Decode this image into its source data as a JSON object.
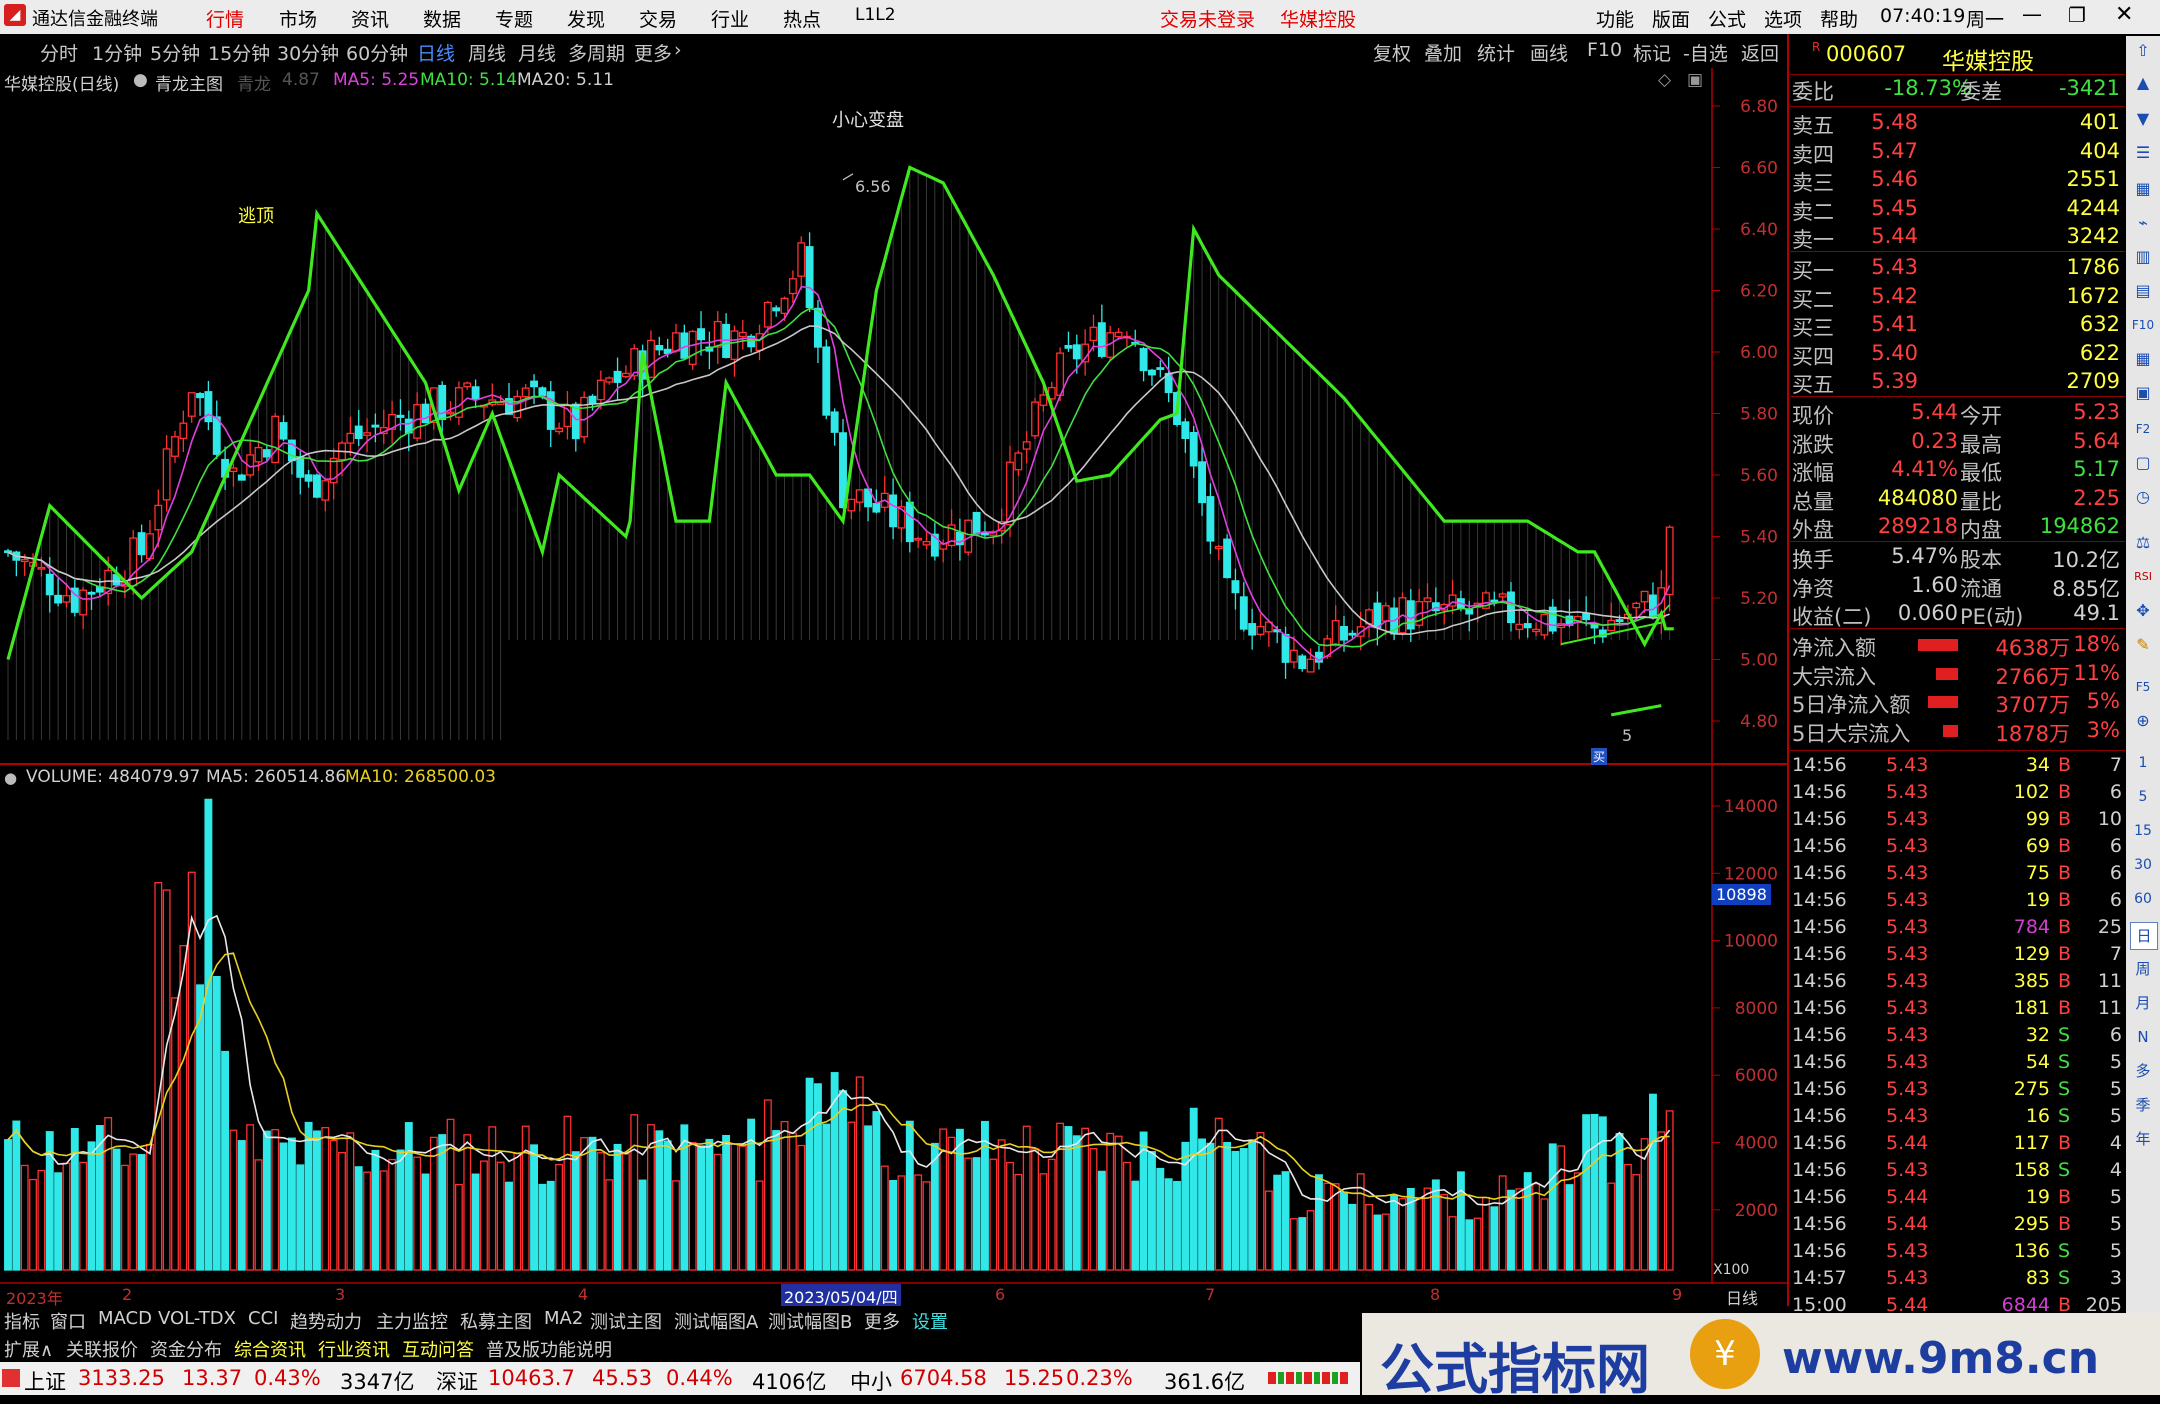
{
  "titlebar": {
    "app_name": "通达信金融终端",
    "menu": [
      "行情",
      "市场",
      "资讯",
      "数据",
      "专题",
      "发现",
      "交易",
      "行业",
      "热点",
      "L1L2"
    ],
    "trade_status": "交易未登录",
    "stock_name": "华媒控股",
    "right_menu": [
      "功能",
      "版面",
      "公式",
      "选项",
      "帮助"
    ],
    "clock": "07:40:19",
    "weekday": "周一"
  },
  "periods": [
    "分时",
    "1分钟",
    "5分钟",
    "15分钟",
    "30分钟",
    "60分钟",
    "日线",
    "周线",
    "月线",
    "多周期",
    "更多"
  ],
  "period_active": "日线",
  "chart_tools": [
    "复权",
    "叠加",
    "统计",
    "画线",
    "F10",
    "标记",
    "-自选",
    "返回"
  ],
  "main_info": {
    "title": "华媒控股(日线)",
    "indicator": "青龙主图",
    "ind_name": "青龙",
    "ind_value": "4.87",
    "ma5": "MA5: 5.25",
    "ma10": "MA10: 5.14",
    "ma20": "MA20: 5.11"
  },
  "annotations": {
    "warn": "小心变盘",
    "top_escape": "逃顶",
    "high_mark": "6.56",
    "low_num": "5",
    "low_tag": "买"
  },
  "price_axis": [
    "6.80",
    "6.60",
    "6.40",
    "6.20",
    "6.00",
    "5.80",
    "5.60",
    "5.40",
    "5.20",
    "5.00",
    "4.80"
  ],
  "volume_info": {
    "label": "VOLUME: 484079.97",
    "ma5": "MA5: 260514.86",
    "ma10": "MA10: 268500.03"
  },
  "volume_axis": [
    "14000",
    "12000",
    "10000",
    "8000",
    "6000",
    "4000",
    "2000"
  ],
  "volume_highlight": "10898",
  "volume_unit": "X100",
  "date_axis": {
    "year": "2023年",
    "m2": "2",
    "m3": "3",
    "m4": "4",
    "cursor": "2023/05/04/四",
    "m6": "6",
    "m7": "7",
    "m8": "8",
    "m9": "9",
    "period": "日线"
  },
  "quote": {
    "code": "000607",
    "name": "华媒控股",
    "flag": "R",
    "weibi_label": "委比",
    "weibi": "-18.73%",
    "weicha_label": "委差",
    "weicha": "-3421",
    "asks": [
      {
        "l": "卖五",
        "p": "5.48",
        "v": "401"
      },
      {
        "l": "卖四",
        "p": "5.47",
        "v": "404"
      },
      {
        "l": "卖三",
        "p": "5.46",
        "v": "2551"
      },
      {
        "l": "卖二",
        "p": "5.45",
        "v": "4244"
      },
      {
        "l": "卖一",
        "p": "5.44",
        "v": "3242"
      }
    ],
    "bids": [
      {
        "l": "买一",
        "p": "5.43",
        "v": "1786"
      },
      {
        "l": "买二",
        "p": "5.42",
        "v": "1672"
      },
      {
        "l": "买三",
        "p": "5.41",
        "v": "632"
      },
      {
        "l": "买四",
        "p": "5.40",
        "v": "622"
      },
      {
        "l": "买五",
        "p": "5.39",
        "v": "2709"
      }
    ],
    "stats1": [
      {
        "a": "现价",
        "b": "5.44",
        "c": "今开",
        "d": "5.23"
      },
      {
        "a": "涨跌",
        "b": "0.23",
        "c": "最高",
        "d": "5.64"
      },
      {
        "a": "涨幅",
        "b": "4.41%",
        "c": "最低",
        "d": "5.17"
      },
      {
        "a": "总量",
        "b": "484080",
        "c": "量比",
        "d": "2.25"
      },
      {
        "a": "外盘",
        "b": "289218",
        "c": "内盘",
        "d": "194862"
      }
    ],
    "stats2": [
      {
        "a": "换手",
        "b": "5.47%",
        "c": "股本",
        "d": "10.2亿"
      },
      {
        "a": "净资",
        "b": "1.60",
        "c": "流通",
        "d": "8.85亿"
      },
      {
        "a": "收益(二)",
        "b": "0.060",
        "c": "PE(动)",
        "d": "49.1"
      }
    ],
    "flows": [
      {
        "a": "净流入额",
        "b": "4638万",
        "c": "18%",
        "w": 40
      },
      {
        "a": "大宗流入",
        "b": "2766万",
        "c": "11%",
        "w": 22
      },
      {
        "a": "5日净流入额",
        "b": "3707万",
        "c": "5%",
        "w": 30
      },
      {
        "a": "5日大宗流入",
        "b": "1878万",
        "c": "3%",
        "w": 15
      }
    ]
  },
  "ticks": [
    {
      "t": "14:56",
      "p": "5.43",
      "v": "34",
      "s": "B",
      "n": "7"
    },
    {
      "t": "14:56",
      "p": "5.43",
      "v": "102",
      "s": "B",
      "n": "6"
    },
    {
      "t": "14:56",
      "p": "5.43",
      "v": "99",
      "s": "B",
      "n": "10"
    },
    {
      "t": "14:56",
      "p": "5.43",
      "v": "69",
      "s": "B",
      "n": "6"
    },
    {
      "t": "14:56",
      "p": "5.43",
      "v": "75",
      "s": "B",
      "n": "6"
    },
    {
      "t": "14:56",
      "p": "5.43",
      "v": "19",
      "s": "B",
      "n": "6"
    },
    {
      "t": "14:56",
      "p": "5.43",
      "v": "784",
      "s": "B",
      "n": "25"
    },
    {
      "t": "14:56",
      "p": "5.43",
      "v": "129",
      "s": "B",
      "n": "7"
    },
    {
      "t": "14:56",
      "p": "5.43",
      "v": "385",
      "s": "B",
      "n": "11"
    },
    {
      "t": "14:56",
      "p": "5.43",
      "v": "181",
      "s": "B",
      "n": "11"
    },
    {
      "t": "14:56",
      "p": "5.43",
      "v": "32",
      "s": "S",
      "n": "6"
    },
    {
      "t": "14:56",
      "p": "5.43",
      "v": "54",
      "s": "S",
      "n": "5"
    },
    {
      "t": "14:56",
      "p": "5.43",
      "v": "275",
      "s": "S",
      "n": "5"
    },
    {
      "t": "14:56",
      "p": "5.43",
      "v": "16",
      "s": "S",
      "n": "5"
    },
    {
      "t": "14:56",
      "p": "5.44",
      "v": "117",
      "s": "B",
      "n": "4"
    },
    {
      "t": "14:56",
      "p": "5.43",
      "v": "158",
      "s": "S",
      "n": "4"
    },
    {
      "t": "14:56",
      "p": "5.44",
      "v": "19",
      "s": "B",
      "n": "5"
    },
    {
      "t": "14:56",
      "p": "5.44",
      "v": "295",
      "s": "B",
      "n": "5"
    },
    {
      "t": "14:56",
      "p": "5.43",
      "v": "136",
      "s": "S",
      "n": "5"
    },
    {
      "t": "14:57",
      "p": "5.43",
      "v": "83",
      "s": "S",
      "n": "3"
    },
    {
      "t": "15:00",
      "p": "5.44",
      "v": "6844",
      "s": "B",
      "n": "205"
    }
  ],
  "tabs_row1": [
    "指标",
    "窗口",
    "MACD",
    "VOL-TDX",
    "CCI",
    "趋势动力",
    "主力监控",
    "私募主图",
    "MA2",
    "测试主图",
    "测试幅图A",
    "测试幅图B",
    "更多",
    "设置"
  ],
  "tabs_row2": [
    "扩展∧",
    "关联报价",
    "资金分布",
    "综合资讯",
    "行业资讯",
    "互动问答",
    "普及版功能说明"
  ],
  "status": {
    "sh_label": "上证",
    "sh_val": "3133.25",
    "sh_chg": "13.37",
    "sh_pct": "0.43%",
    "sh_amt": "3347亿",
    "sz_label": "深证",
    "sz_val": "10463.7",
    "sz_chg": "45.53",
    "sz_pct": "0.44%",
    "sz_amt": "4106亿",
    "zx_label": "中小",
    "zx_val": "6704.58",
    "zx_chg": "15.25",
    "zx_pct": "0.23%",
    "zx_amt": "361.6亿"
  },
  "toolbar_right": [
    "日",
    "周",
    "月",
    "N",
    "多",
    "季",
    "年",
    "15",
    "30",
    "60",
    "RSI"
  ],
  "banner": {
    "text": "公式指标网",
    "url": "www.9m8.cn"
  }
}
